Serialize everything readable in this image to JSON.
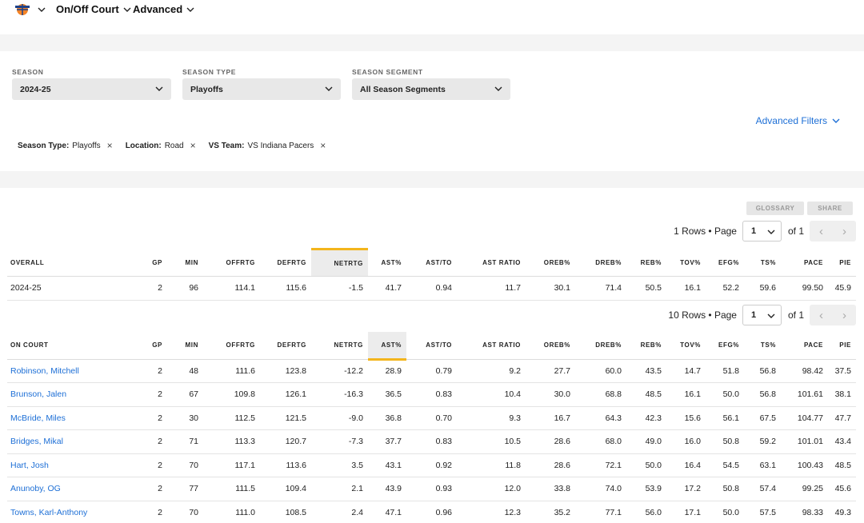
{
  "nav": {
    "items": [
      {
        "label": "On/Off Court"
      },
      {
        "label": "Advanced"
      }
    ]
  },
  "filters": {
    "season": {
      "label": "SEASON",
      "value": "2024-25"
    },
    "season_type": {
      "label": "SEASON TYPE",
      "value": "Playoffs"
    },
    "season_segment": {
      "label": "SEASON SEGMENT",
      "value": "All Season Segments"
    },
    "advanced_label": "Advanced Filters",
    "chips": [
      {
        "key": "Season Type:",
        "value": "Playoffs"
      },
      {
        "key": "Location:",
        "value": "Road"
      },
      {
        "key": "VS Team:",
        "value": "VS Indiana Pacers"
      }
    ]
  },
  "toolbar": {
    "glossary": "GLOSSARY",
    "share": "SHARE"
  },
  "pager_overall": {
    "rows": "1 Rows • Page",
    "page": "1",
    "of": "of 1"
  },
  "pager_oncourt": {
    "rows": "10 Rows • Page",
    "page": "1",
    "of": "of 1"
  },
  "overall": {
    "headers": [
      "OVERALL",
      "GP",
      "MIN",
      "OFFRTG",
      "DEFRTG",
      "NETRTG",
      "AST%",
      "AST/TO",
      "AST RATIO",
      "OREB%",
      "DREB%",
      "REB%",
      "TOV%",
      "EFG%",
      "TS%",
      "PACE",
      "PIE"
    ],
    "rows": [
      [
        "2024-25",
        "2",
        "96",
        "114.1",
        "115.6",
        "-1.5",
        "41.7",
        "0.94",
        "11.7",
        "30.1",
        "71.4",
        "50.5",
        "16.1",
        "52.2",
        "59.6",
        "99.50",
        "45.9"
      ]
    ]
  },
  "oncourt": {
    "headers": [
      "ON COURT",
      "GP",
      "MIN",
      "OFFRTG",
      "DEFRTG",
      "NETRTG",
      "AST%",
      "AST/TO",
      "AST RATIO",
      "OREB%",
      "DREB%",
      "REB%",
      "TOV%",
      "EFG%",
      "TS%",
      "PACE",
      "PIE"
    ],
    "rows": [
      [
        "Robinson, Mitchell",
        "2",
        "48",
        "111.6",
        "123.8",
        "-12.2",
        "28.9",
        "0.79",
        "9.2",
        "27.7",
        "60.0",
        "43.5",
        "14.7",
        "51.8",
        "56.8",
        "98.42",
        "37.5"
      ],
      [
        "Brunson, Jalen",
        "2",
        "67",
        "109.8",
        "126.1",
        "-16.3",
        "36.5",
        "0.83",
        "10.4",
        "30.0",
        "68.8",
        "48.5",
        "16.1",
        "50.0",
        "56.8",
        "101.61",
        "38.1"
      ],
      [
        "McBride, Miles",
        "2",
        "30",
        "112.5",
        "121.5",
        "-9.0",
        "36.8",
        "0.70",
        "9.3",
        "16.7",
        "64.3",
        "42.3",
        "15.6",
        "56.1",
        "67.5",
        "104.77",
        "47.7"
      ],
      [
        "Bridges, Mikal",
        "2",
        "71",
        "113.3",
        "120.7",
        "-7.3",
        "37.7",
        "0.83",
        "10.5",
        "28.6",
        "68.0",
        "49.0",
        "16.0",
        "50.8",
        "59.2",
        "101.01",
        "43.4"
      ],
      [
        "Hart, Josh",
        "2",
        "70",
        "117.1",
        "113.6",
        "3.5",
        "43.1",
        "0.92",
        "11.8",
        "28.6",
        "72.1",
        "50.0",
        "16.4",
        "54.5",
        "63.1",
        "100.43",
        "48.5"
      ],
      [
        "Anunoby, OG",
        "2",
        "77",
        "111.5",
        "109.4",
        "2.1",
        "43.9",
        "0.93",
        "12.0",
        "33.8",
        "74.0",
        "53.9",
        "17.2",
        "50.8",
        "57.4",
        "99.25",
        "45.6"
      ],
      [
        "Towns, Karl-Anthony",
        "2",
        "70",
        "111.0",
        "108.5",
        "2.4",
        "47.1",
        "0.96",
        "12.3",
        "35.2",
        "77.1",
        "56.0",
        "17.1",
        "50.0",
        "57.5",
        "98.33",
        "49.3"
      ]
    ]
  }
}
